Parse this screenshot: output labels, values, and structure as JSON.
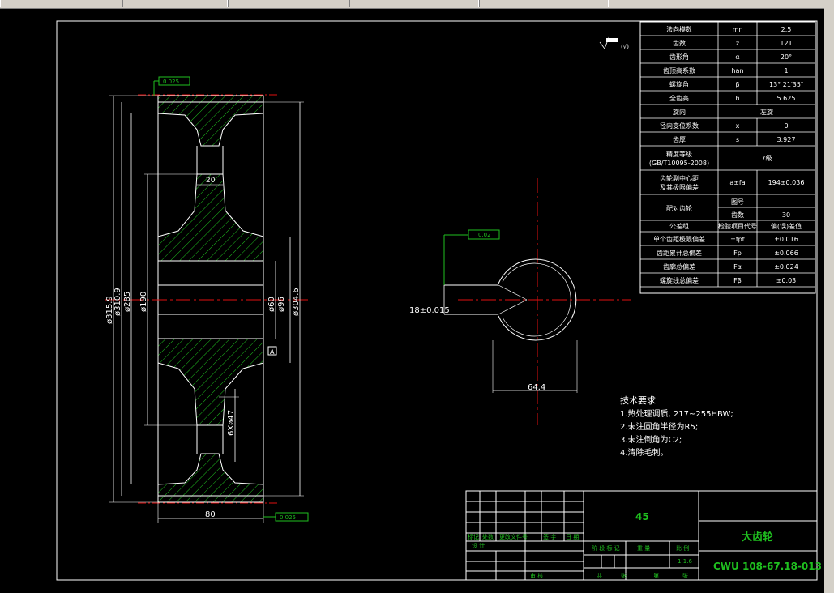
{
  "window": {
    "title": ""
  },
  "drawing": {
    "title": "大齿轮",
    "code": "CWU 108-67.18-013",
    "material": "45",
    "scale": "1:1.6"
  },
  "gear_params": [
    {
      "name": "法向模数",
      "sym": "mn",
      "val": "2.5"
    },
    {
      "name": "齿数",
      "sym": "z",
      "val": "121"
    },
    {
      "name": "齿形角",
      "sym": "α",
      "val": "20°"
    },
    {
      "name": "齿顶高系数",
      "sym": "han",
      "val": "1"
    },
    {
      "name": "螺旋角",
      "sym": "β",
      "val": "13° 21′35″"
    },
    {
      "name": "全齿高",
      "sym": "h",
      "val": "5.625"
    },
    {
      "name": "旋向",
      "sym": "",
      "val": "左旋"
    },
    {
      "name": "径向变位系数",
      "sym": "x",
      "val": "0"
    },
    {
      "name": "齿厚",
      "sym": "s",
      "val": "3.927"
    }
  ],
  "accuracy": {
    "name1": "精度等级",
    "name2": "(GB/T10095-2008)",
    "val": "7级"
  },
  "center": {
    "name1": "齿轮副中心距",
    "name2": "及其极限偏差",
    "sym": "a±fa",
    "val": "194±0.036"
  },
  "mating": {
    "name": "配对齿轮",
    "k1": "图号",
    "v1": "",
    "k2": "齿数",
    "v2": "30"
  },
  "tol_header": {
    "name": "公差组",
    "sym": "检验项目代号",
    "val": "偏(误)差值"
  },
  "tolerances": [
    {
      "name": "单个齿距极限偏差",
      "sym": "±fpt",
      "val": "±0.016"
    },
    {
      "name": "齿距累计总偏差",
      "sym": "Fp",
      "val": "±0.066"
    },
    {
      "name": "齿廓总偏差",
      "sym": "Fα",
      "val": "±0.024"
    },
    {
      "name": "螺旋线总偏差",
      "sym": "Fβ",
      "val": "±0.03"
    }
  ],
  "tech_req": {
    "title": "技术要求",
    "items": [
      "1.热处理调质, 217~255HBW;",
      "2.未注圆角半径为R5;",
      "3.未注倒角为C2;",
      "4.清除毛刺。"
    ]
  },
  "dims": {
    "d1": "ø315.9",
    "d2": "ø310.9",
    "d3": "ø285",
    "d4": "ø190",
    "d5": "ø60",
    "d6": "ø96",
    "d7": "ø304.6",
    "web": "20",
    "holes": "6Xø47",
    "width": "80",
    "keyway": "18±0.015",
    "keydepth": "64.4",
    "tol1": "0.025",
    "tol2": "0.025",
    "tol3": "0.02",
    "datum": "A",
    "rough_corner": "(√)"
  },
  "titleblock": {
    "r1": [
      "标记",
      "处数",
      "更改文件号",
      "签 字",
      "日 期"
    ],
    "r2": "设 计",
    "r3": [
      "阶 段 标 记",
      "重 量",
      "比 例"
    ],
    "r4": [
      "共",
      "张",
      "第",
      "张"
    ],
    "approve": "审 核"
  }
}
